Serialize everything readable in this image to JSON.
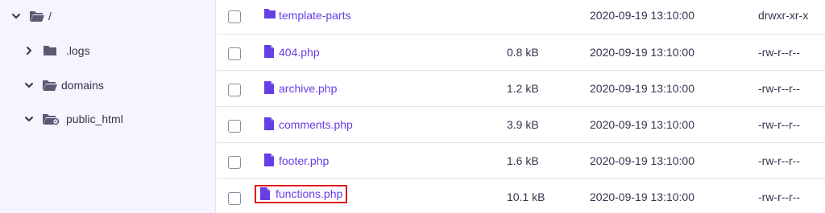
{
  "colors": {
    "accent": "#673de6",
    "highlight_border": "#e0141e",
    "sidebar_bg": "#f4f5ff",
    "text": "#36344d"
  },
  "tree": [
    {
      "label": "/",
      "icon": "folder-open-icon",
      "chevron": "chevron-down-icon"
    },
    {
      "label": ".logs",
      "icon": "folder-icon",
      "chevron": "chevron-right-icon"
    },
    {
      "label": "domains",
      "icon": "folder-open-icon",
      "chevron": "chevron-down-icon"
    },
    {
      "label": "public_html",
      "icon": "folder-link-icon",
      "chevron": "chevron-down-icon"
    }
  ],
  "files": [
    {
      "name": "template-parts",
      "type": "folder",
      "size": "",
      "date": "2020-09-19 13:10:00",
      "perms": "drwxr-xr-x"
    },
    {
      "name": "404.php",
      "type": "file",
      "size": "0.8 kB",
      "date": "2020-09-19 13:10:00",
      "perms": "-rw-r--r--"
    },
    {
      "name": "archive.php",
      "type": "file",
      "size": "1.2 kB",
      "date": "2020-09-19 13:10:00",
      "perms": "-rw-r--r--"
    },
    {
      "name": "comments.php",
      "type": "file",
      "size": "3.9 kB",
      "date": "2020-09-19 13:10:00",
      "perms": "-rw-r--r--"
    },
    {
      "name": "footer.php",
      "type": "file",
      "size": "1.6 kB",
      "date": "2020-09-19 13:10:00",
      "perms": "-rw-r--r--"
    },
    {
      "name": "functions.php",
      "type": "file",
      "size": "10.1 kB",
      "date": "2020-09-19 13:10:00",
      "perms": "-rw-r--r--",
      "highlighted": true
    }
  ]
}
